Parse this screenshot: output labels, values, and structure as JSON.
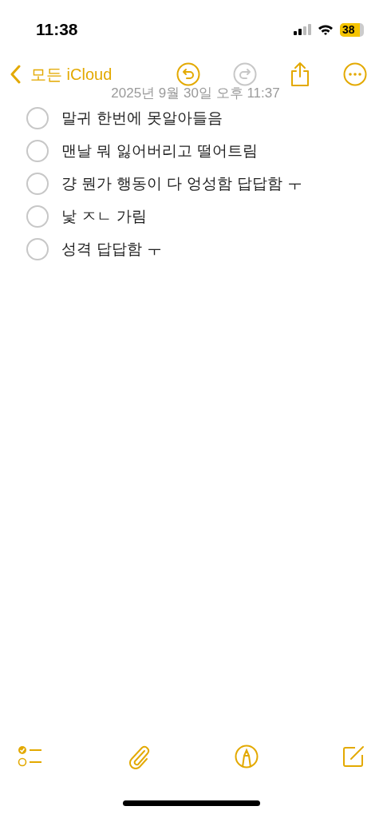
{
  "status_bar": {
    "time": "11:38",
    "battery": "38"
  },
  "nav": {
    "back_label": "모든 iCloud",
    "undo_disabled": false,
    "redo_disabled": true
  },
  "note": {
    "date": "2025년 9월 30일 오후 11:37",
    "checklist": [
      {
        "text": "말귀 한번에 못알아들음",
        "checked": false
      },
      {
        "text": "맨날 뭐 잃어버리고 떨어트림",
        "checked": false
      },
      {
        "text": "걍 뭔가 행동이 다 엉성함 답답함 ㅜ",
        "checked": false
      },
      {
        "text": "낯 ㅈㄴ 가림",
        "checked": false
      },
      {
        "text": "성격 답답함 ㅜ",
        "checked": false
      }
    ]
  }
}
